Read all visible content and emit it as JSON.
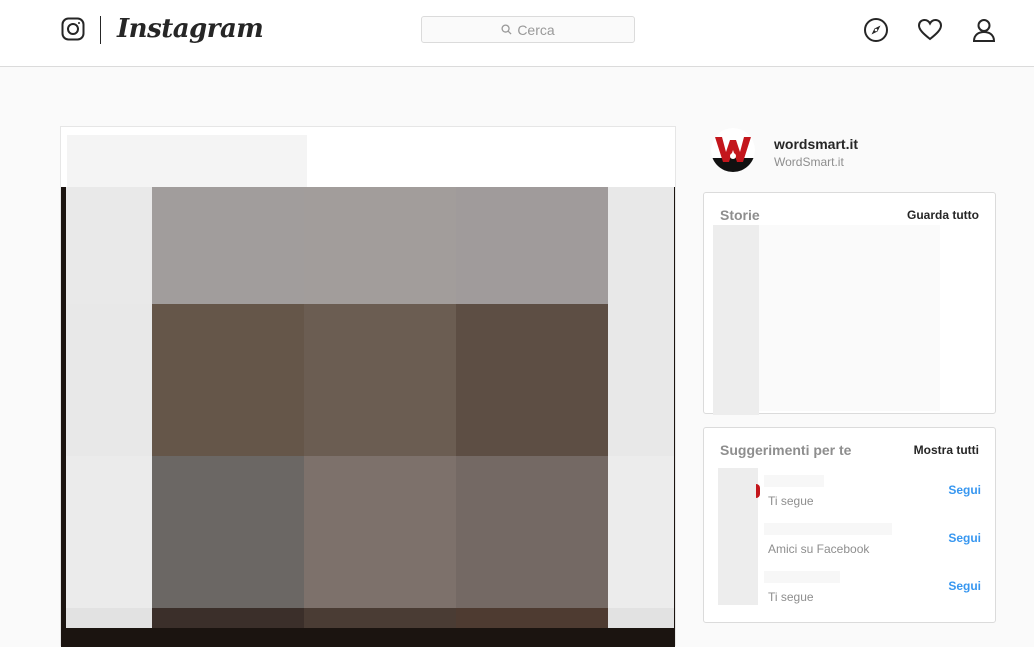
{
  "header": {
    "wordmark": "Instagram",
    "search": {
      "placeholder": "Cerca"
    },
    "icons": [
      "instagram-glyph-icon",
      "compass-icon",
      "heart-icon",
      "user-icon"
    ]
  },
  "profile": {
    "username": "wordsmart.it",
    "full_name": "WordSmart.it"
  },
  "stories": {
    "title": "Storie",
    "action": "Guarda tutto"
  },
  "suggestions": {
    "title": "Suggerimenti per te",
    "action": "Mostra tutti",
    "items": [
      {
        "subtitle": "Ti segue",
        "follow_label": "Segui"
      },
      {
        "subtitle": "Amici su Facebook",
        "follow_label": "Segui"
      },
      {
        "subtitle": "Ti segue",
        "follow_label": "Segui"
      }
    ]
  },
  "colors": {
    "link": "#3897f0",
    "border": "#dbdbdb",
    "background": "#fafafa",
    "brand_red": "#c3161c"
  }
}
